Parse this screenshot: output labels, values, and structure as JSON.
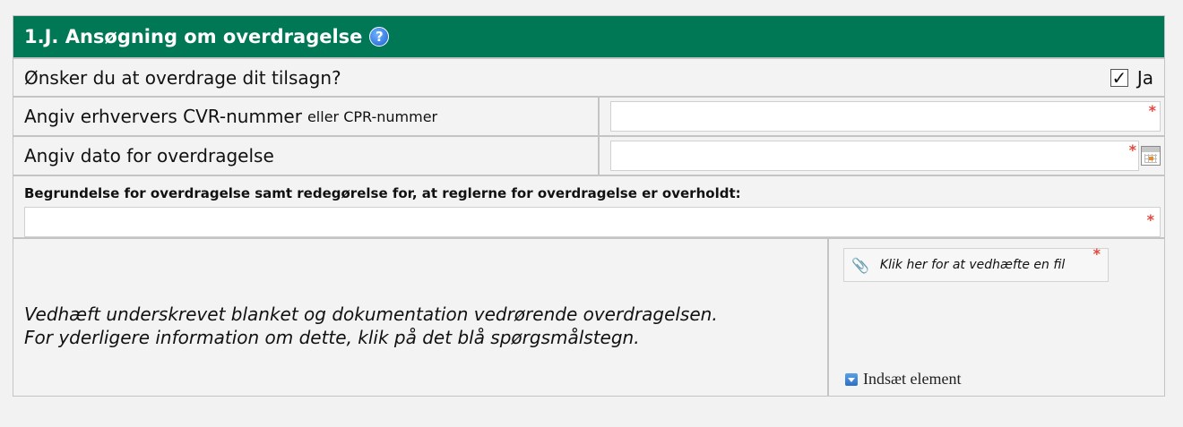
{
  "section": {
    "title": "1.J. Ansøgning om overdragelse",
    "help_icon": "question-circle-icon"
  },
  "transfer_question": {
    "label": "Ønsker du at overdrage dit tilsagn?",
    "checkbox_label": "Ja",
    "checked": true
  },
  "cvr_field": {
    "label_main": "Angiv erhververs CVR-nummer",
    "label_small": "eller CPR-nummer",
    "value": "",
    "required_mark": "*"
  },
  "date_field": {
    "label": "Angiv dato for overdragelse",
    "value": "",
    "required_mark": "*",
    "calendar_icon": "calendar-icon"
  },
  "justification": {
    "label": "Begrundelse for overdragelse samt redegørelse for, at reglerne for overdragelse er overholdt:",
    "value": "",
    "required_mark": "*"
  },
  "attachment": {
    "description": "Vedhæft underskrevet blanket og dokumentation vedrørende overdragelsen. For yderligere information om dette, klik på det blå spørgsmålstegn.",
    "button_label": "Klik her for at vedhæfte en fil",
    "required_mark": "*",
    "insert_label": "Indsæt element"
  },
  "colors": {
    "header_bg": "#007856",
    "required": "#e8453c",
    "border": "#c4c4c4"
  }
}
